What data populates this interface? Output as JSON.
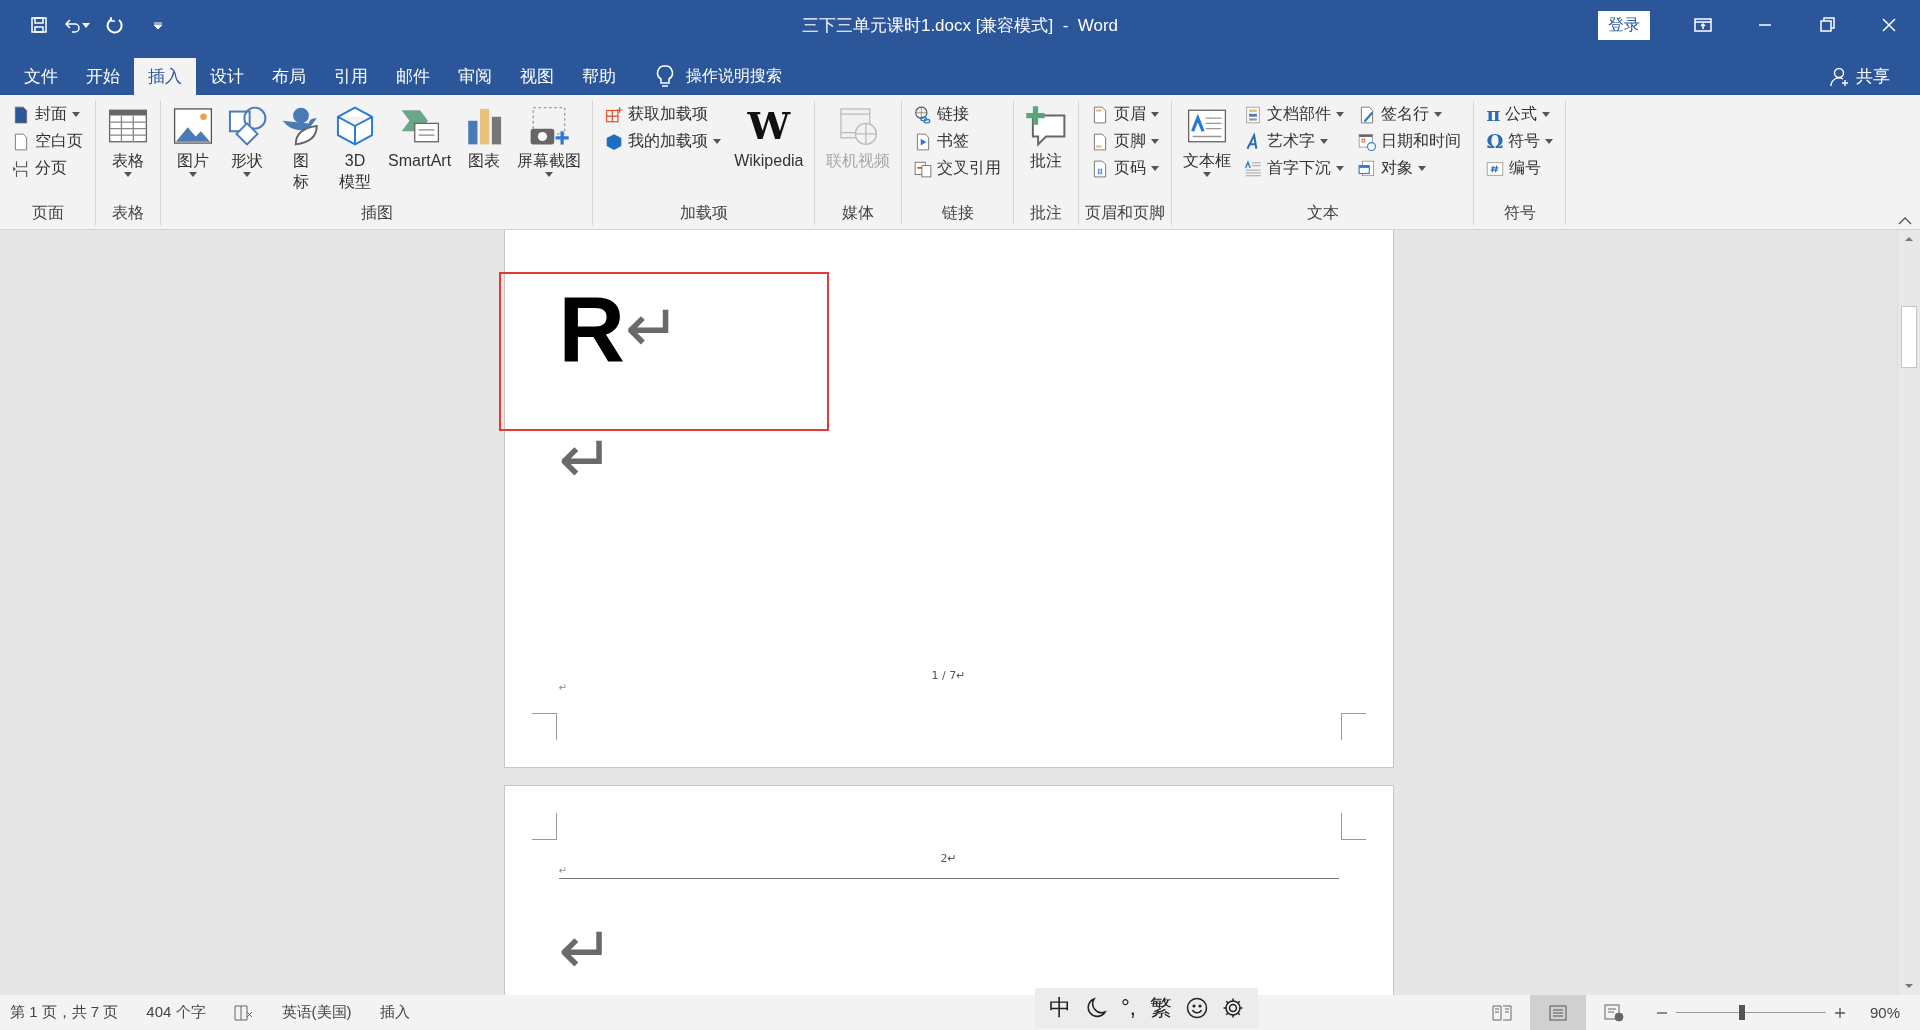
{
  "title_bar": {
    "title": "三下三单元课时1.docx [兼容模式]  -  Word",
    "sign_in": "登录"
  },
  "tabs": [
    {
      "label": "文件",
      "selected": false
    },
    {
      "label": "开始",
      "selected": false
    },
    {
      "label": "插入",
      "selected": true
    },
    {
      "label": "设计",
      "selected": false
    },
    {
      "label": "布局",
      "selected": false
    },
    {
      "label": "引用",
      "selected": false
    },
    {
      "label": "邮件",
      "selected": false
    },
    {
      "label": "审阅",
      "selected": false
    },
    {
      "label": "视图",
      "selected": false
    },
    {
      "label": "帮助",
      "selected": false
    }
  ],
  "tell_me": {
    "placeholder": "操作说明搜索"
  },
  "share": "共享",
  "ribbon": {
    "groups": [
      {
        "label": "页面",
        "items": [
          {
            "kind": "small",
            "label": "封面",
            "dropdown": true
          },
          {
            "kind": "small",
            "label": "空白页",
            "dropdown": false
          },
          {
            "kind": "small",
            "label": "分页",
            "dropdown": false
          }
        ]
      },
      {
        "label": "表格",
        "items": [
          {
            "kind": "large",
            "label": "表格",
            "dropdown": true
          }
        ]
      },
      {
        "label": "插图",
        "items": [
          {
            "kind": "large",
            "label": "图片",
            "dropdown": true
          },
          {
            "kind": "large",
            "label": "形状",
            "dropdown": true
          },
          {
            "kind": "large",
            "label": "图标",
            "dropdown": false,
            "stacked": true
          },
          {
            "kind": "large",
            "label": "3D\n模型",
            "dropdown": false
          },
          {
            "kind": "large",
            "label": "SmartArt",
            "dropdown": false
          },
          {
            "kind": "large",
            "label": "图表",
            "dropdown": false
          },
          {
            "kind": "large",
            "label": "屏幕截图",
            "dropdown": true
          }
        ]
      },
      {
        "label": "加载项",
        "items": [
          {
            "kind": "small",
            "label": "获取加载项",
            "dropdown": false
          },
          {
            "kind": "small",
            "label": "我的加载项",
            "dropdown": true
          },
          {
            "kind": "large",
            "label": "Wikipedia",
            "dropdown": false,
            "logo": "W"
          }
        ]
      },
      {
        "label": "媒体",
        "items": [
          {
            "kind": "large",
            "label": "联机视频",
            "dropdown": false,
            "disabled": true
          }
        ]
      },
      {
        "label": "链接",
        "items": [
          {
            "kind": "small",
            "label": "链接",
            "dropdown": false
          },
          {
            "kind": "small",
            "label": "书签",
            "dropdown": false
          },
          {
            "kind": "small",
            "label": "交叉引用",
            "dropdown": false
          }
        ]
      },
      {
        "label": "批注",
        "items": [
          {
            "kind": "large",
            "label": "批注",
            "dropdown": false
          }
        ]
      },
      {
        "label": "页眉和页脚",
        "items": [
          {
            "kind": "small",
            "label": "页眉",
            "dropdown": true
          },
          {
            "kind": "small",
            "label": "页脚",
            "dropdown": true
          },
          {
            "kind": "small",
            "label": "页码",
            "dropdown": true
          }
        ]
      },
      {
        "label": "文本",
        "items": [
          {
            "kind": "large",
            "label": "文本框",
            "dropdown": true
          },
          {
            "kind": "small",
            "label": "文档部件",
            "dropdown": true
          },
          {
            "kind": "small",
            "label": "艺术字",
            "dropdown": true
          },
          {
            "kind": "small",
            "label": "首字下沉",
            "dropdown": true
          },
          {
            "kind": "small",
            "label": "签名行",
            "dropdown": true
          },
          {
            "kind": "small",
            "label": "日期和时间",
            "dropdown": false
          },
          {
            "kind": "small",
            "label": "对象",
            "dropdown": true
          }
        ]
      },
      {
        "label": "符号",
        "items": [
          {
            "kind": "small",
            "label": "公式",
            "dropdown": true,
            "logo": "π"
          },
          {
            "kind": "small",
            "label": "符号",
            "dropdown": true,
            "logo": "Ω"
          },
          {
            "kind": "small",
            "label": "编号",
            "dropdown": false
          }
        ]
      }
    ]
  },
  "pages": [
    {
      "body": [
        {
          "text": "R",
          "mark": "↵",
          "highlighted": true
        },
        {
          "mark": "↵",
          "highlighted": false
        }
      ],
      "footer": {
        "page_number": "1 / 7↵",
        "empty_line": "↵"
      }
    },
    {
      "header": {
        "page_number": "2↵",
        "empty_line": "↵"
      },
      "body": [
        {
          "mark": "↵",
          "highlighted": false
        }
      ]
    }
  ],
  "status_bar": {
    "page": "第 1 页，共 7 页",
    "words": "404 个字",
    "language": "英语(美国)",
    "mode": "插入",
    "ime": {
      "mode": "中",
      "punctuation": "°,",
      "script": "繁"
    },
    "views": [
      {
        "selected": false
      },
      {
        "selected": true
      },
      {
        "selected": false
      }
    ],
    "zoom": {
      "level": 0.44,
      "reading": "90%"
    }
  }
}
